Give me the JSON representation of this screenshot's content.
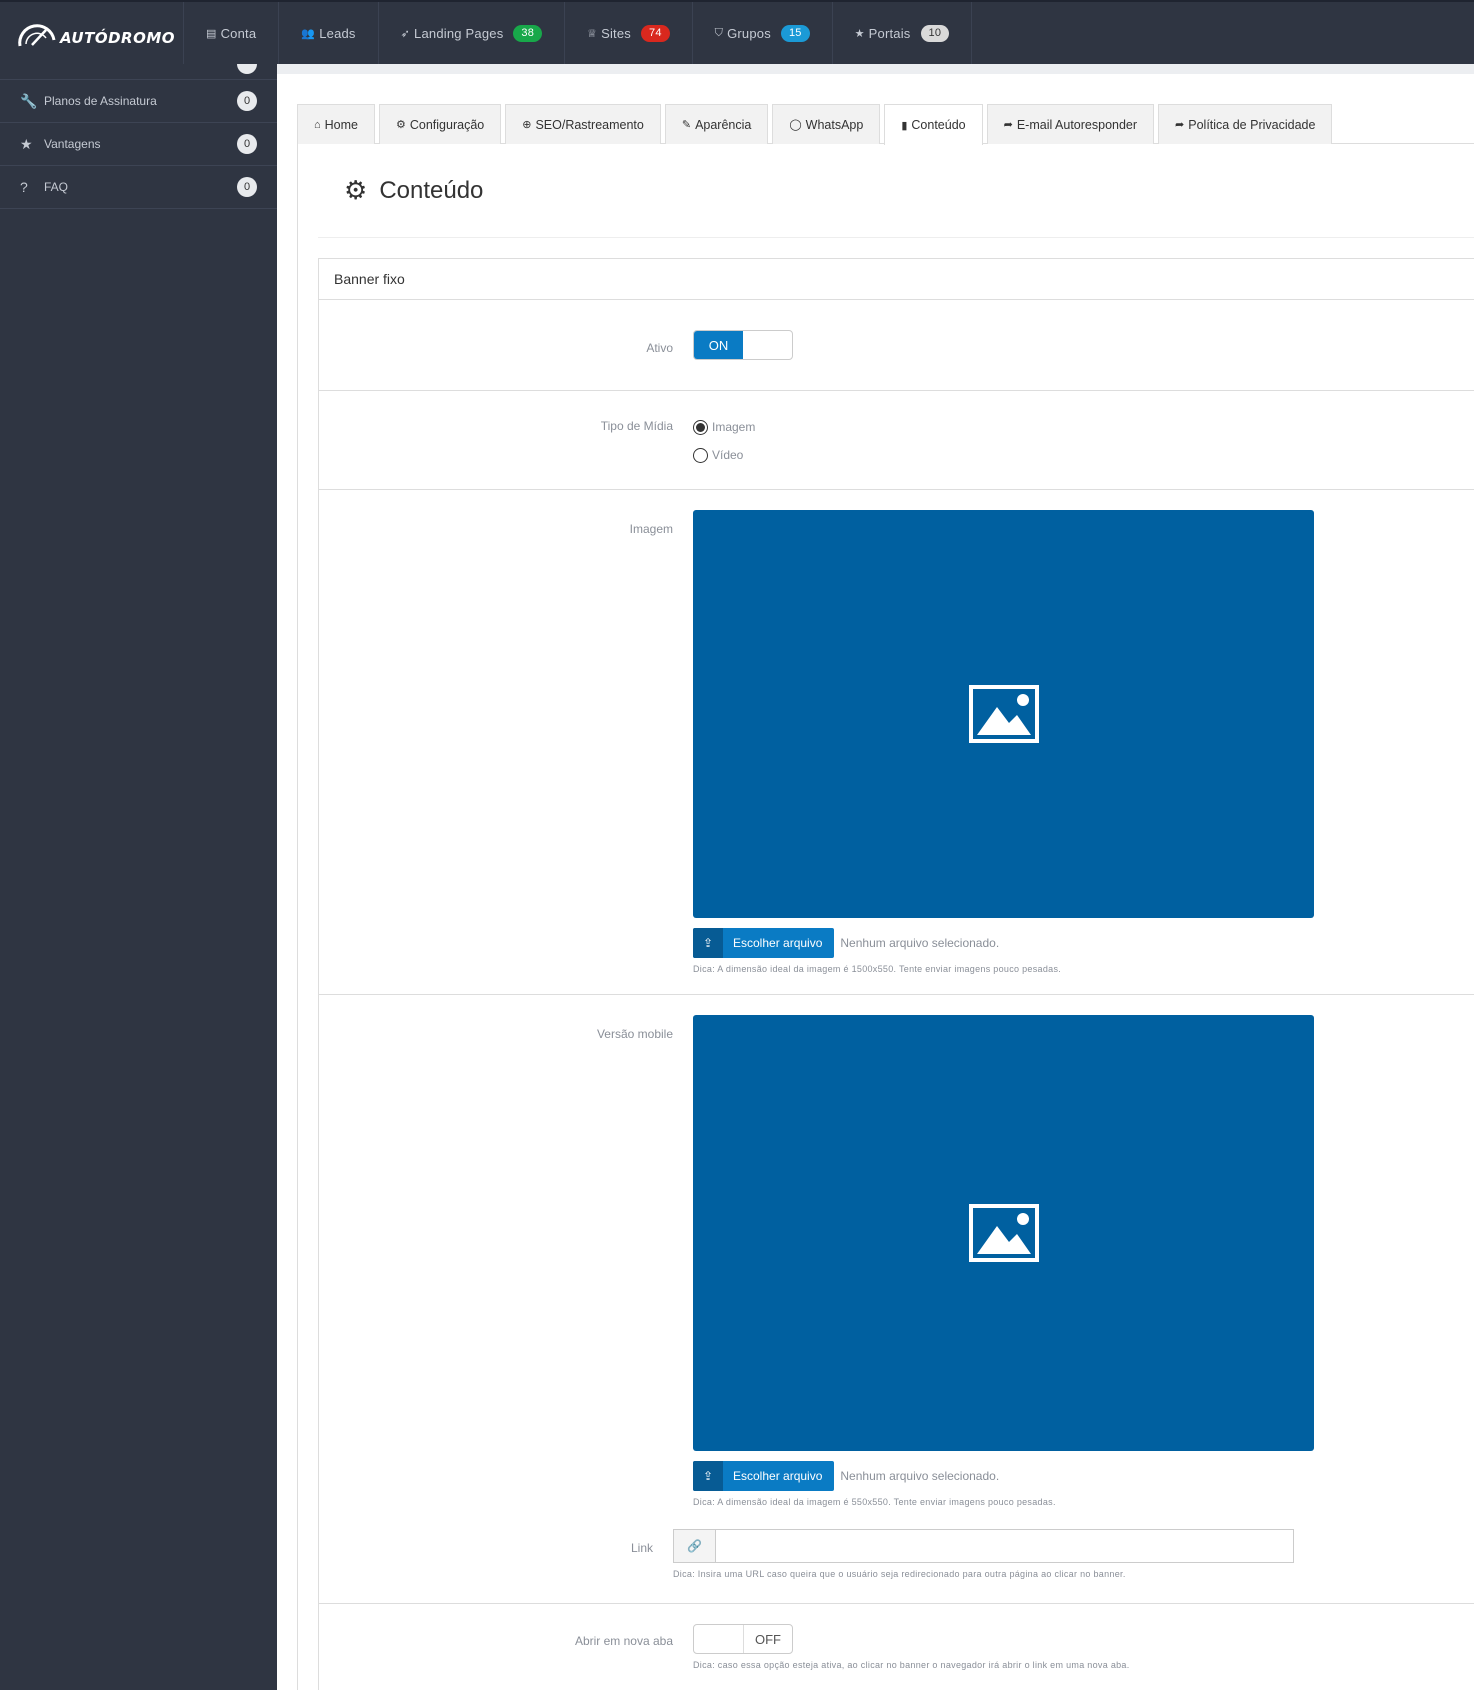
{
  "brand": {
    "name": "AUTÓDROMO"
  },
  "topnav": [
    {
      "label": "Conta",
      "icon": "briefcase-icon",
      "glyph": "▤"
    },
    {
      "label": "Leads",
      "icon": "users-icon",
      "glyph": "👥"
    },
    {
      "label": "Landing Pages",
      "icon": "rocket-icon",
      "glyph": "➶",
      "badge": "38",
      "badge_color": "#18a84a"
    },
    {
      "label": "Sites",
      "icon": "trophy-icon",
      "glyph": "♕",
      "badge": "74",
      "badge_color": "#d9281e"
    },
    {
      "label": "Grupos",
      "icon": "tags-icon",
      "glyph": "⛉",
      "badge": "15",
      "badge_color": "#1b9ad6"
    },
    {
      "label": "Portais",
      "icon": "star-icon",
      "glyph": "★",
      "badge": "10",
      "badge_color": "#d9d9d9"
    }
  ],
  "sidebar": {
    "items": [
      {
        "label": "Planos de Assinatura",
        "icon": "wrench-icon",
        "glyph": "🔧",
        "count": "0"
      },
      {
        "label": "Vantagens",
        "icon": "star-icon",
        "glyph": "★",
        "count": "0"
      },
      {
        "label": "FAQ",
        "icon": "question-icon",
        "glyph": "?",
        "count": "0"
      }
    ]
  },
  "tabs": [
    {
      "label": "Home",
      "icon": "home-icon",
      "glyph": "⌂"
    },
    {
      "label": "Configuração",
      "icon": "gear-icon",
      "glyph": "⚙"
    },
    {
      "label": "SEO/Rastreamento",
      "icon": "crosshair-icon",
      "glyph": "⊕"
    },
    {
      "label": "Aparência",
      "icon": "magic-wand-icon",
      "glyph": "✎"
    },
    {
      "label": "WhatsApp",
      "icon": "whatsapp-icon",
      "glyph": "◯"
    },
    {
      "label": "Conteúdo",
      "icon": "book-icon",
      "glyph": "▮",
      "active": true
    },
    {
      "label": "E-mail Autoresponder",
      "icon": "share-icon",
      "glyph": "➦"
    },
    {
      "label": "Política de Privacidade",
      "icon": "share-icon",
      "glyph": "➦"
    }
  ],
  "page": {
    "title": "Conteúdo"
  },
  "section": {
    "title": "Banner fixo",
    "ativo": {
      "label": "Ativo",
      "state_label": "ON"
    },
    "tipo": {
      "label": "Tipo de Mídia",
      "options": [
        "Imagem",
        "Vídeo"
      ],
      "selected": "Imagem"
    },
    "imagem": {
      "label": "Imagem",
      "button": "Escolher arquivo",
      "status": "Nenhum arquivo selecionado.",
      "hint": "Dica: A dimensão ideal da imagem é 1500x550. Tente enviar imagens pouco pesadas."
    },
    "mobile": {
      "label": "Versão mobile",
      "button": "Escolher arquivo",
      "status": "Nenhum arquivo selecionado.",
      "hint": "Dica: A dimensão ideal da imagem é 550x550. Tente enviar imagens pouco pesadas."
    },
    "link": {
      "label": "Link",
      "value": "",
      "hint": "Dica: Insira uma URL caso queira que o usuário seja redirecionado para outra página ao clicar no banner."
    },
    "nova_aba": {
      "label": "Abrir em nova aba",
      "state_label": "OFF",
      "hint": "Dica: caso essa opção esteja ativa, ao clicar no banner o navegador irá abrir o link em uma nova aba."
    }
  },
  "colors": {
    "nav_bg": "#2f3542",
    "accent": "#0a7bc4",
    "placeholder": "#0060a0"
  }
}
